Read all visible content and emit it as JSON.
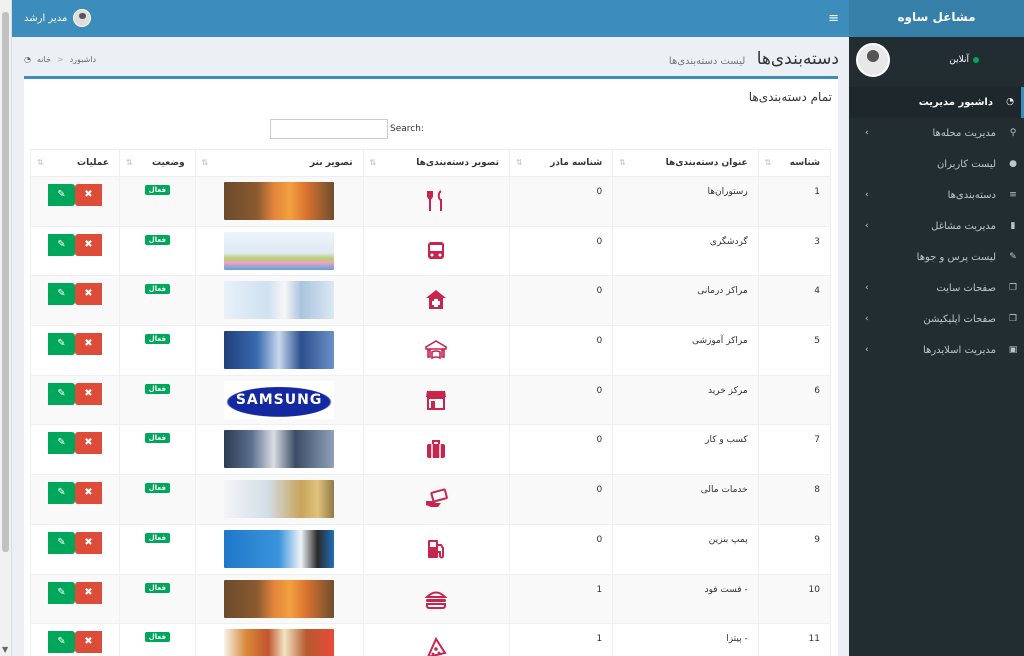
{
  "brand": "مشاغل ساوه",
  "topbar": {
    "user_name": "مدیر ارشد"
  },
  "sidebar": {
    "status": "آنلاین",
    "items": [
      {
        "label": "داشبور مدیریت",
        "icon": "dashboard-icon",
        "glyph": "◔",
        "active": true,
        "chevron": false
      },
      {
        "label": "مدیریت محله‌ها",
        "icon": "map-marker-icon",
        "glyph": "⚲",
        "active": false,
        "chevron": true
      },
      {
        "label": "لیست کاربران",
        "icon": "user-icon",
        "glyph": "●",
        "active": false,
        "chevron": false
      },
      {
        "label": "دسته‌بندی‌ها",
        "icon": "list-icon",
        "glyph": "≡",
        "active": false,
        "chevron": true
      },
      {
        "label": "مدیریت مشاغل",
        "icon": "building-icon",
        "glyph": "▮",
        "active": false,
        "chevron": true
      },
      {
        "label": "لیست پرس و جوها",
        "icon": "pencil-icon",
        "glyph": "✎",
        "active": false,
        "chevron": false
      },
      {
        "label": "صفحات سایت",
        "icon": "copy-icon",
        "glyph": "❐",
        "active": false,
        "chevron": true
      },
      {
        "label": "صفحات اپلیکیشن",
        "icon": "copy-icon",
        "glyph": "❐",
        "active": false,
        "chevron": true
      },
      {
        "label": "مدیریت اسلایدرها",
        "icon": "image-icon",
        "glyph": "▣",
        "active": false,
        "chevron": true
      }
    ]
  },
  "header": {
    "title": "دسته‌بندی‌ها",
    "subtitle": "لیست دسته‌بندی‌ها"
  },
  "breadcrumb": {
    "home": "خانه",
    "current": "داشبورد"
  },
  "box": {
    "title": "تمام دسته‌بندی‌ها",
    "search_label": "Search:",
    "search_value": ""
  },
  "table": {
    "columns": [
      "شناسه",
      "عنوان دسته‌بندی‌ها",
      "شناسه مادر",
      "تصویر دسته‌بندی‌ها",
      "تصویر بنر",
      "وضعیت",
      "عملیات"
    ],
    "status_label": "فعال",
    "rows": [
      {
        "id": "1",
        "title": "رستوران‌ها",
        "parent": "0",
        "icon": "utensils-icon",
        "banner": "food-banner-image"
      },
      {
        "id": "3",
        "title": "گردشگری",
        "parent": "0",
        "icon": "bus-icon",
        "banner": "tourism-banner-image"
      },
      {
        "id": "4",
        "title": "مراکز درمانی",
        "parent": "0",
        "icon": "hospital-icon",
        "banner": "medical-banner-image"
      },
      {
        "id": "5",
        "title": "مراکز آموزشی",
        "parent": "0",
        "icon": "book-open-icon",
        "banner": "education-banner-image"
      },
      {
        "id": "6",
        "title": "مرکز خرید",
        "parent": "0",
        "icon": "store-icon",
        "banner": "samsung-banner-image",
        "banner_text": "SAMSUNG"
      },
      {
        "id": "7",
        "title": "کسب و کار",
        "parent": "0",
        "icon": "briefcase-icon",
        "banner": "business-banner-image"
      },
      {
        "id": "8",
        "title": "خدمات مالی",
        "parent": "0",
        "icon": "money-hand-icon",
        "banner": "finance-banner-image"
      },
      {
        "id": "9",
        "title": "پمپ بنزین",
        "parent": "0",
        "icon": "gas-pump-icon",
        "banner": "fuel-banner-image"
      },
      {
        "id": "10",
        "title": "- فست فود",
        "parent": "1",
        "icon": "burger-icon",
        "banner": "food-banner-image"
      },
      {
        "id": "11",
        "title": "- پیتزا",
        "parent": "1",
        "icon": "pizza-slice-icon",
        "banner": "pizza-banner-image"
      }
    ]
  }
}
